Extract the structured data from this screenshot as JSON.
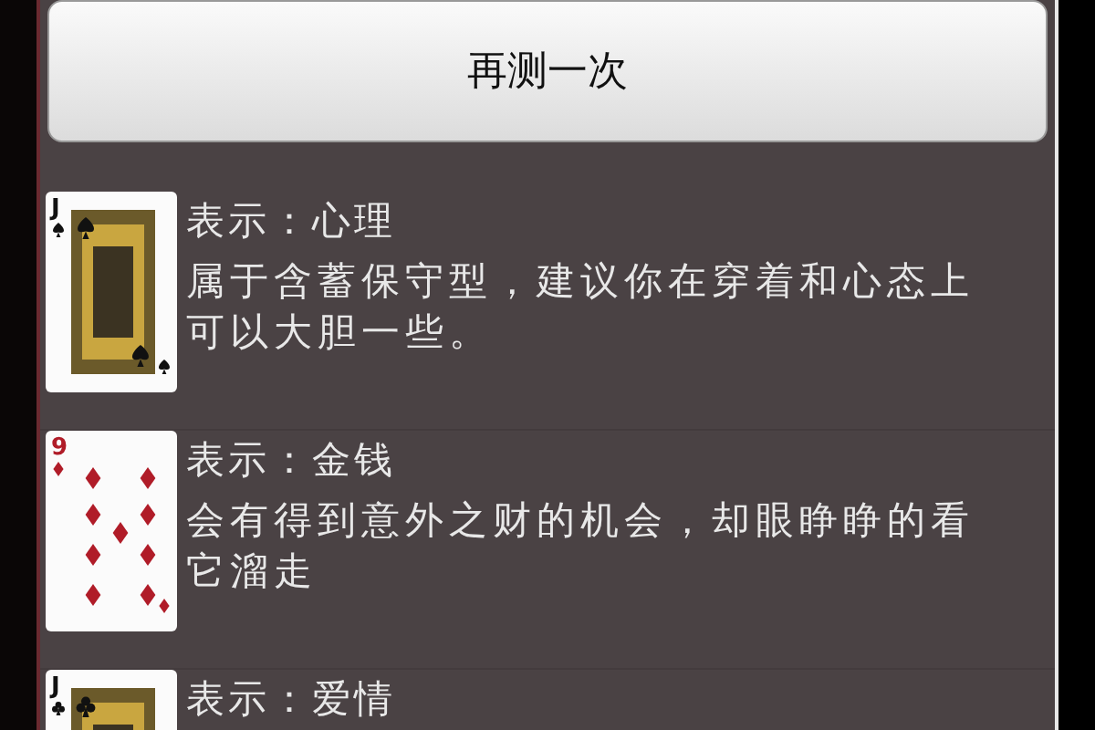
{
  "retest_button": {
    "label": "再测一次"
  },
  "results": [
    {
      "card": {
        "rank": "J",
        "kind": "spades",
        "face": true
      },
      "title": "表示：心理",
      "description": "属于含蓄保守型，建议你在穿着和心态上可以大胆一些。"
    },
    {
      "card": {
        "rank": "9",
        "kind": "diamonds",
        "face": false
      },
      "title": "表示：金钱",
      "description": "会有得到意外之财的机会，却眼睁睁的看它溜走"
    },
    {
      "card": {
        "rank": "J",
        "kind": "clubs",
        "face": true
      },
      "title": "表示：爱情"
    }
  ]
}
